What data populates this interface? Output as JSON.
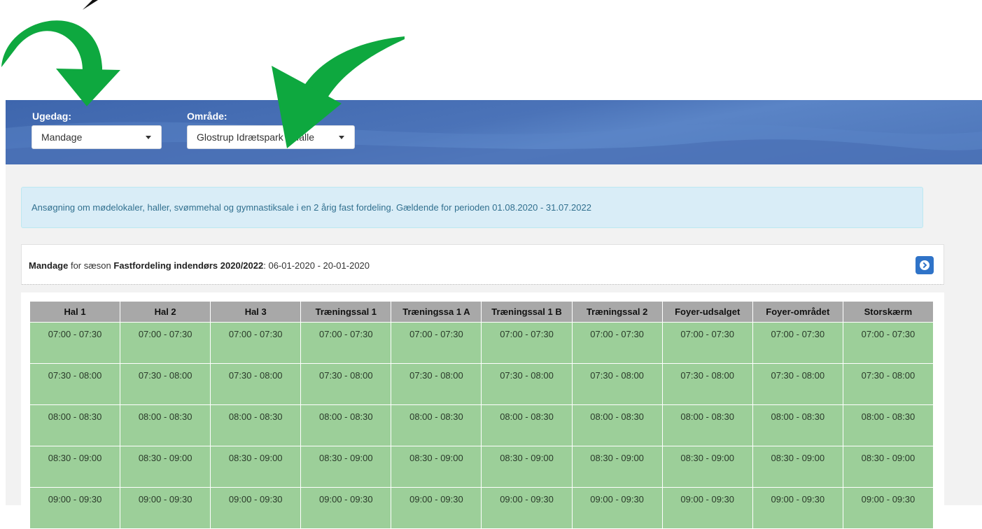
{
  "filters": {
    "weekday_label": "Ugedag:",
    "weekday_value": "Mandage",
    "area_label": "Område:",
    "area_value": "Glostrup Idrætspark - Halle"
  },
  "info": {
    "text": "Ansøgning om mødelokaler, haller, svømmehal og gymnastiksale i en 2 årig fast fordeling. Gældende for perioden 01.08.2020 - 31.07.2022"
  },
  "season": {
    "day": "Mandage",
    "mid_text": " for sæson ",
    "season_name": "Fastfordeling indendørs 2020/2022",
    "range": ": 06-01-2020 - 20-01-2020"
  },
  "table": {
    "columns": [
      "Hal 1",
      "Hal 2",
      "Hal 3",
      "Træningssal 1",
      "Træningssa 1 A",
      "Træningssal 1 B",
      "Træningssal 2",
      "Foyer-udsalget",
      "Foyer-området",
      "Storskærm"
    ],
    "slots": [
      "07:00 - 07:30",
      "07:30 - 08:00",
      "08:00 - 08:30",
      "08:30 - 09:00",
      "09:00 - 09:30"
    ]
  },
  "colors": {
    "header_blue": "#4b73b8",
    "slot_green": "#9ccf99",
    "column_header_gray": "#a8a8a8",
    "arrow_green": "#0ea83f"
  },
  "icons": [
    "chevron-circle-right-icon",
    "caret-down-icon",
    "curved-arrow-icon"
  ]
}
